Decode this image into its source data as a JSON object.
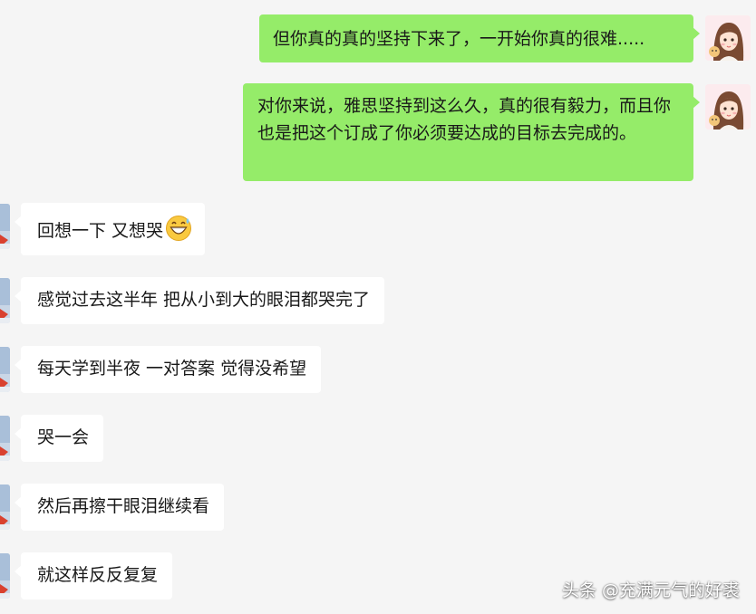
{
  "messages": [
    {
      "side": "out",
      "text": "但你真的真的坚持下来了，一开始你真的很难....."
    },
    {
      "side": "out",
      "text": "对你来说，雅思坚持到这么久，真的很有毅力，而且你也是把这个订成了你必须要达成的目标去完成的。"
    },
    {
      "side": "in",
      "text": "回想一下 又想哭",
      "emoji": "grinning-sweat-emoji"
    },
    {
      "side": "in",
      "text": "感觉过去这半年 把从小到大的眼泪都哭完了"
    },
    {
      "side": "in",
      "text": "每天学到半夜 一对答案 觉得没希望"
    },
    {
      "side": "in",
      "text": "哭一会"
    },
    {
      "side": "in",
      "text": "然后再擦干眼泪继续看"
    },
    {
      "side": "in",
      "text": "就这样反反复复"
    }
  ],
  "watermark": "头条 @充满元气的好裘",
  "colors": {
    "background": "#f5f5f5",
    "outgoing_bubble": "#95ec69",
    "incoming_bubble": "#ffffff"
  }
}
